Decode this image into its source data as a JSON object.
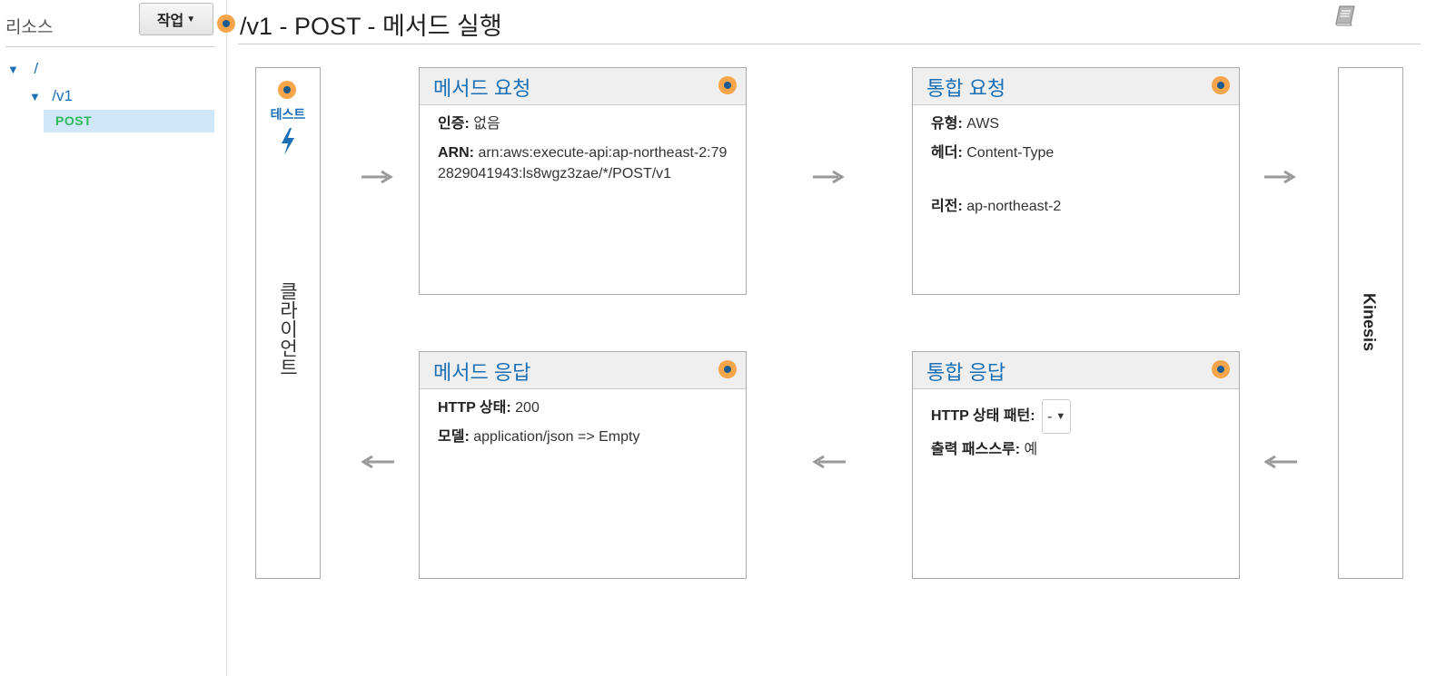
{
  "sidebar": {
    "title": "리소스",
    "actions_label": "작업",
    "tree": {
      "root": "/",
      "v1": "/v1",
      "post": "POST"
    }
  },
  "header": {
    "title": "/v1 - POST - 메서드 실행"
  },
  "client": {
    "test_label": "테스트",
    "label": "클라이언트"
  },
  "backend": {
    "label": "Kinesis"
  },
  "method_request": {
    "title": "메서드 요청",
    "auth_label": "인증:",
    "auth_value": "없음",
    "arn_label": "ARN:",
    "arn_value": "arn:aws:execute-api:ap-northeast-2:792829041943:ls8wgz3zae/*/POST/v1"
  },
  "integration_request": {
    "title": "통합 요청",
    "type_label": "유형:",
    "type_value": "AWS",
    "header_label": "헤더:",
    "header_value": "Content-Type",
    "region_label": "리전:",
    "region_value": "ap-northeast-2"
  },
  "method_response": {
    "title": "메서드 응답",
    "status_label": "HTTP 상태:",
    "status_value": "200",
    "model_label": "모델:",
    "model_value": "application/json => Empty"
  },
  "integration_response": {
    "title": "통합 응답",
    "pattern_label": "HTTP 상태 패턴:",
    "pattern_value": "-",
    "passthrough_label": "출력 패스스루:",
    "passthrough_value": "예"
  },
  "colors": {
    "link_blue": "#1a6fb5",
    "accent_orange": "#f7a54b",
    "post_green": "#2dbb5b",
    "arrow_gray": "#9a9a9a"
  }
}
